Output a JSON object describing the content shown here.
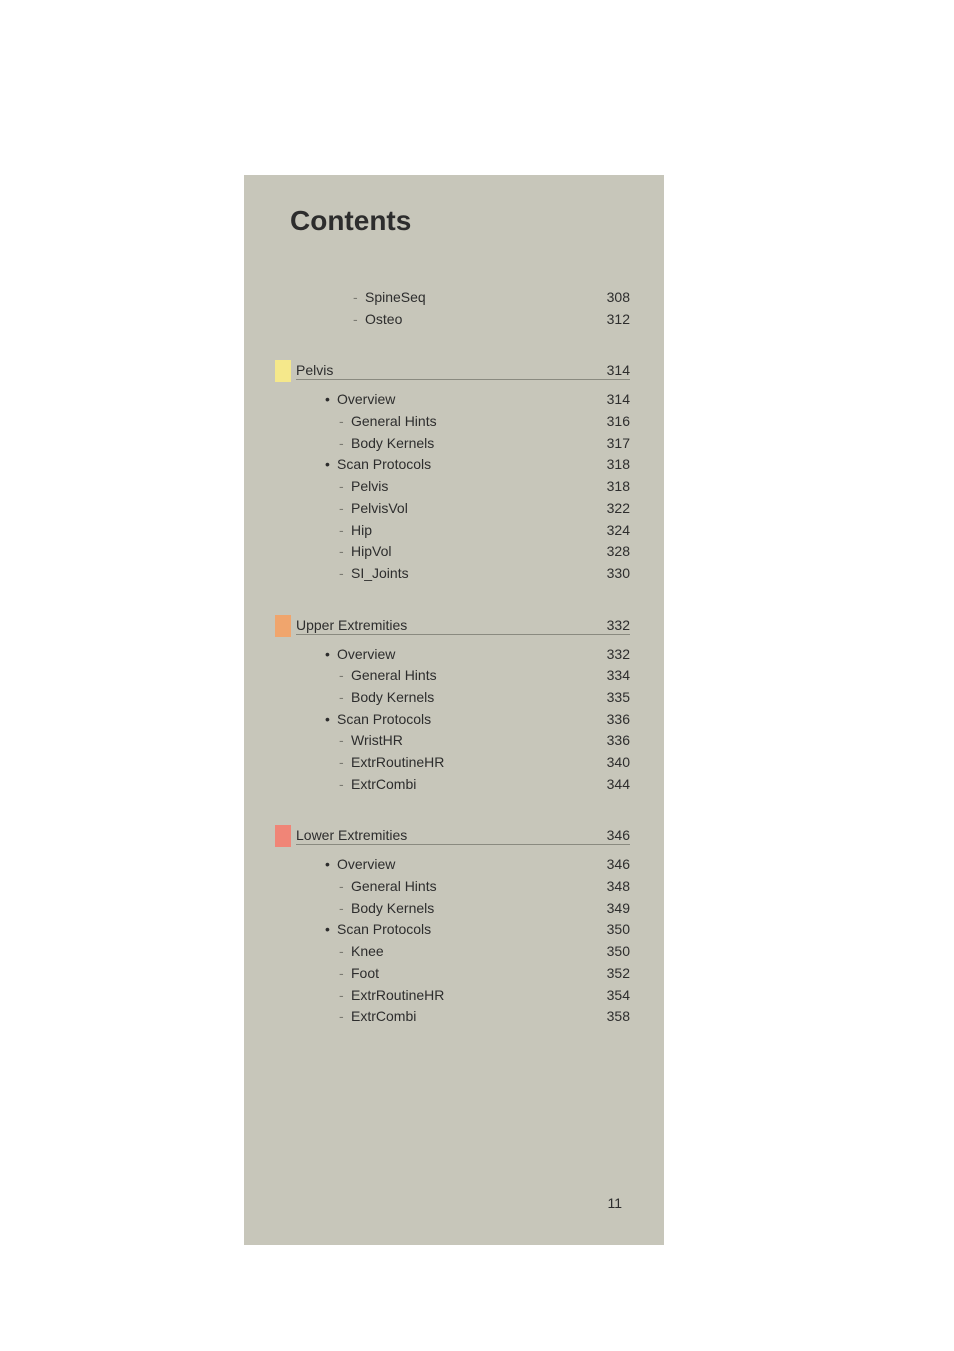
{
  "title": "Contents",
  "page_number": "11",
  "ungrouped_entries": [
    {
      "type": "dash",
      "label": "SpineSeq",
      "page": "308"
    },
    {
      "type": "dash",
      "label": "Osteo",
      "page": "312"
    }
  ],
  "sections": [
    {
      "color": "yellow",
      "title": "Pelvis",
      "page": "314",
      "entries": [
        {
          "type": "bullet",
          "level": 1,
          "label": "Overview",
          "page": "314"
        },
        {
          "type": "dash",
          "level": 2,
          "label": "General Hints",
          "page": "316"
        },
        {
          "type": "dash",
          "level": 2,
          "label": "Body Kernels",
          "page": "317"
        },
        {
          "type": "bullet",
          "level": 1,
          "label": "Scan Protocols",
          "page": "318"
        },
        {
          "type": "dash",
          "level": 2,
          "label": "Pelvis",
          "page": "318"
        },
        {
          "type": "dash",
          "level": 2,
          "label": "PelvisVol",
          "page": "322"
        },
        {
          "type": "dash",
          "level": 2,
          "label": "Hip",
          "page": "324"
        },
        {
          "type": "dash",
          "level": 2,
          "label": "HipVol",
          "page": "328"
        },
        {
          "type": "dash",
          "level": 2,
          "label": "SI_Joints",
          "page": "330"
        }
      ]
    },
    {
      "color": "orange",
      "title": "Upper Extremities",
      "page": "332",
      "entries": [
        {
          "type": "bullet",
          "level": 1,
          "label": "Overview",
          "page": "332"
        },
        {
          "type": "dash",
          "level": 2,
          "label": "General Hints",
          "page": "334"
        },
        {
          "type": "dash",
          "level": 2,
          "label": "Body Kernels",
          "page": "335"
        },
        {
          "type": "bullet",
          "level": 1,
          "label": "Scan Protocols",
          "page": "336"
        },
        {
          "type": "dash",
          "level": 2,
          "label": "WristHR",
          "page": "336"
        },
        {
          "type": "dash",
          "level": 2,
          "label": "ExtrRoutineHR",
          "page": "340"
        },
        {
          "type": "dash",
          "level": 2,
          "label": "ExtrCombi",
          "page": "344"
        }
      ]
    },
    {
      "color": "salmon",
      "title": "Lower Extremities",
      "page": "346",
      "entries": [
        {
          "type": "bullet",
          "level": 1,
          "label": "Overview",
          "page": "346"
        },
        {
          "type": "dash",
          "level": 2,
          "label": "General Hints",
          "page": "348"
        },
        {
          "type": "dash",
          "level": 2,
          "label": "Body Kernels",
          "page": "349"
        },
        {
          "type": "bullet",
          "level": 1,
          "label": "Scan Protocols",
          "page": "350"
        },
        {
          "type": "dash",
          "level": 2,
          "label": "Knee",
          "page": "350"
        },
        {
          "type": "dash",
          "level": 2,
          "label": "Foot",
          "page": "352"
        },
        {
          "type": "dash",
          "level": 2,
          "label": "ExtrRoutineHR",
          "page": "354"
        },
        {
          "type": "dash",
          "level": 2,
          "label": "ExtrCombi",
          "page": "358"
        }
      ]
    }
  ]
}
